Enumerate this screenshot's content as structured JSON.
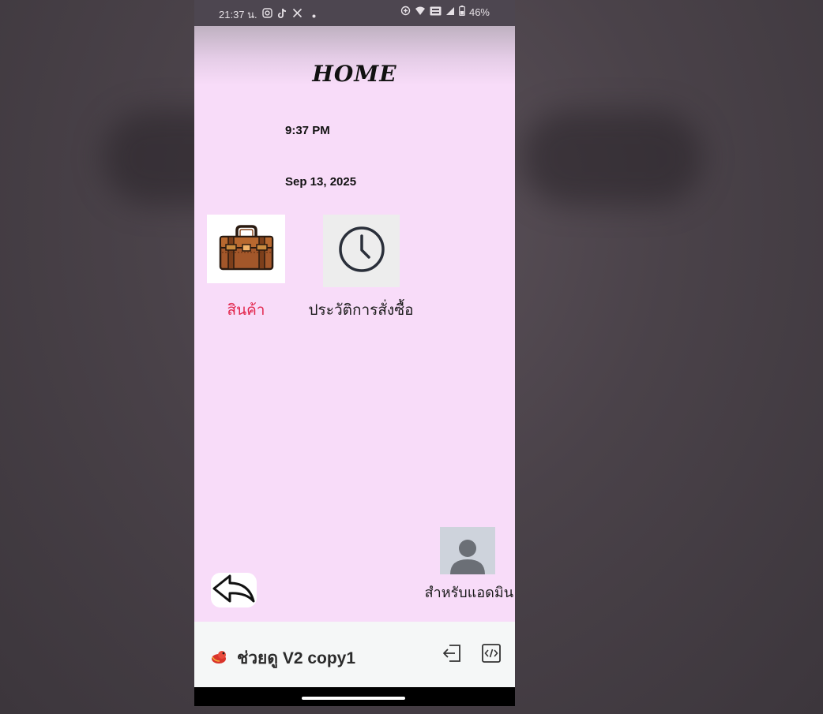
{
  "status_bar": {
    "time": "21:37 น.",
    "battery": "46%",
    "left_icons": [
      "instagram-icon",
      "tiktok-icon",
      "x-icon",
      "dot-icon"
    ],
    "right_icons": [
      "data-saver-icon",
      "wifi-icon",
      "volte-icon",
      "signal-icon",
      "battery-icon"
    ]
  },
  "home": {
    "title": "HOME",
    "time": "9:37 PM",
    "date": "Sep 13, 2025"
  },
  "tiles": [
    {
      "label": "สินค้า",
      "icon": "briefcase-icon",
      "color": "#e2244b"
    },
    {
      "label": "ประวัติการสั่งซื้อ",
      "icon": "clock-icon",
      "color": "#1a1a1a"
    }
  ],
  "admin": {
    "label": "สำหรับแอดมิน",
    "icon": "user-avatar-icon"
  },
  "back_button": {
    "icon": "reply-arrow-icon"
  },
  "bottom_bar": {
    "app_name": "ช่วยดู V2 copy1",
    "app_icon": "app-logo-icon",
    "actions": [
      "exit-icon",
      "code-icon"
    ]
  },
  "colors": {
    "background": "#f8dcf9",
    "accent_red": "#e2244b",
    "status_bar": "#4d4650"
  }
}
